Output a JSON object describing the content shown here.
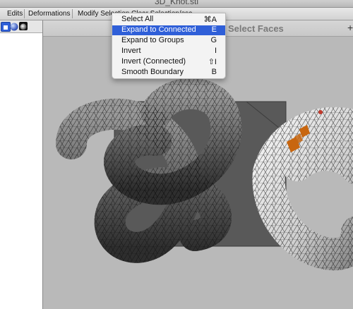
{
  "window": {
    "title": "3D_Knot.stl"
  },
  "menubar": {
    "items": [
      "Edits",
      "Deformations",
      "Modify Selection",
      "Clear Selection/esc"
    ]
  },
  "viewport": {
    "title": "Select Faces",
    "plus": "+"
  },
  "menu": {
    "items": [
      {
        "label": "Select All",
        "shortcut": "⌘A"
      },
      {
        "label": "Expand to Connected",
        "shortcut": "E"
      },
      {
        "label": "Expand to Groups",
        "shortcut": "G"
      },
      {
        "label": "Invert",
        "shortcut": "I"
      },
      {
        "label": "Invert (Connected)",
        "shortcut": "⇧I"
      },
      {
        "label": "Smooth Boundary",
        "shortcut": "B"
      }
    ],
    "highlighted_index": 1
  },
  "colors": {
    "highlight": "#2f5fd8",
    "selected_faces": "#c8660f"
  },
  "icons": [
    "select-tool-icon",
    "sphere-icon",
    "cube-icon",
    "knot-mesh-icon"
  ]
}
